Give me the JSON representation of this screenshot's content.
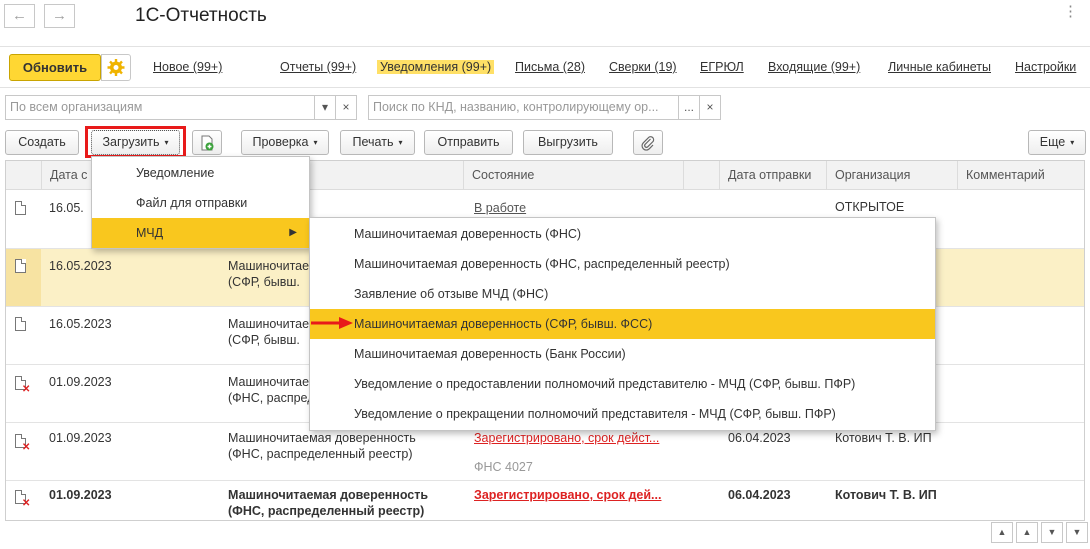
{
  "window": {
    "title": "1С-Отчетность",
    "back_icon": "arrow-left-icon",
    "forward_icon": "arrow-right-icon",
    "more_glyph": "⋮"
  },
  "tabs": {
    "refresh": "Обновить",
    "items": [
      {
        "label": "Новое (99+)"
      },
      {
        "label": "Отчеты (99+)"
      },
      {
        "label": "Уведомления (99+)"
      },
      {
        "label": "Письма (28)"
      },
      {
        "label": "Сверки (19)"
      },
      {
        "label": "ЕГРЮЛ"
      },
      {
        "label": "Входящие (99+)"
      },
      {
        "label": "Личные кабинеты"
      },
      {
        "label": "Настройки"
      }
    ],
    "active_color": "#ffe066"
  },
  "filters": {
    "org_placeholder": "По всем организациям",
    "search_placeholder": "Поиск по КНД, названию, контролирующему ор...",
    "dropdown_glyph": "▾",
    "ellipsis_glyph": "...",
    "clear_glyph": "×"
  },
  "toolbar": {
    "create": "Создать",
    "load": "Загрузить",
    "check": "Проверка",
    "print": "Печать",
    "send": "Отправить",
    "export": "Выгрузить",
    "more": "Еще",
    "arrow": "▾"
  },
  "grid": {
    "headers": [
      "Дата с",
      "",
      "Состояние",
      "Дата отправки",
      "Организация",
      "Комментарий"
    ],
    "rows": [
      {
        "date": "16.05.",
        "name1": "",
        "name2": "",
        "state": "В работе",
        "state2": "",
        "sent": "",
        "org1": "ОТКРЫТОЕ",
        "org2": ""
      },
      {
        "date": "16.05.2023",
        "name1": "Машиночитае",
        "name2": "(СФР, бывш.",
        "state": "",
        "state2": "",
        "sent": "",
        "org1": "",
        "org2": ""
      },
      {
        "date": "16.05.2023",
        "name1": "Машиночитае",
        "name2": "(СФР, бывш.",
        "state": "",
        "state2": "",
        "sent": "",
        "org1": "",
        "org2": ""
      },
      {
        "date": "01.09.2023",
        "name1": "Машиночитае",
        "name2": "(ФНС, распреде",
        "state": "",
        "state2": "",
        "sent": "",
        "org1": "",
        "org2": ""
      },
      {
        "date": "01.09.2023",
        "name1": "Машиночитаемая доверенность",
        "name2": "(ФНС, распределенный реестр)",
        "state": "Зарегистрировано, срок дейст...",
        "state2": "ФНС 4027",
        "sent": "06.04.2023",
        "org1": "Котович Т. В. ИП",
        "org2": ""
      },
      {
        "date": "01.09.2023",
        "name1": "Машиночитаемая доверенность",
        "name2": "(ФНС, распределенный реестр)",
        "state": "Зарегистрировано, срок дей...",
        "state2": "",
        "sent": "06.04.2023",
        "org1": "Котович Т. В. ИП",
        "org2": ""
      }
    ]
  },
  "menu_load": {
    "items": [
      {
        "label": "Уведомление"
      },
      {
        "label": "Файл для отправки"
      },
      {
        "label": "МЧД"
      }
    ],
    "submenu_arrow": "▶"
  },
  "menu_mchd": {
    "items": [
      {
        "label": "Машиночитаемая доверенность (ФНС)"
      },
      {
        "label": "Машиночитаемая доверенность (ФНС, распределенный реестр)"
      },
      {
        "label": "Заявление об отзыве МЧД (ФНС)"
      },
      {
        "label": "Машиночитаемая доверенность (СФР, бывш. ФСС)"
      },
      {
        "label": "Машиночитаемая доверенность (Банк России)"
      },
      {
        "label": "Уведомление о предоставлении полномочий представителю - МЧД (СФР, бывш. ПФР)"
      },
      {
        "label": "Уведомление о прекращении полномочий представителя - МЧД (СФР, бывш. ПФР)"
      }
    ]
  },
  "pager": {
    "first": "first-page-icon",
    "up": "page-up-icon",
    "down": "page-down-icon",
    "last": "last-page-icon"
  },
  "colors": {
    "accent": "#ffd733",
    "highlight": "#f9c71e",
    "selected_row": "#fbf0c6",
    "error": "#dd2222",
    "annotation": "#e81a1a"
  }
}
